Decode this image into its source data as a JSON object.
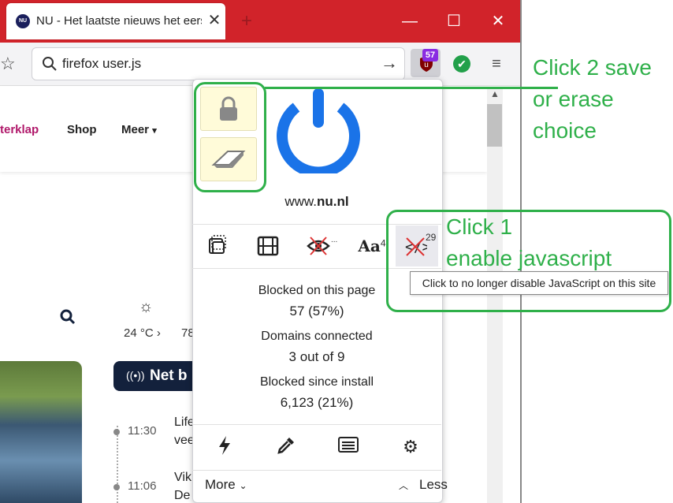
{
  "browser": {
    "tab_title": "NU - Het laatste nieuws het eerst op NU.nl",
    "tab_favicon": "NU",
    "close_glyph": "✕",
    "new_tab_glyph": "+",
    "window_controls": {
      "minimize": "—",
      "maximize": "☐",
      "close": "✕"
    },
    "url_text": "firefox user.js",
    "go_glyph": "→",
    "bookmark_glyph": "☆",
    "menu_glyph": "≡",
    "ubo_badge": "57",
    "check_glyph": "✔"
  },
  "page": {
    "nav_items": [
      "terklap",
      "Shop",
      "Meer"
    ],
    "weather_temp": "24 °C ›",
    "weather_temp2": "78",
    "net_label": "Net b",
    "timeline": [
      {
        "time": "11:30",
        "line1": "Life",
        "line2": "vee"
      },
      {
        "time": "11:06",
        "line1": "Vik",
        "line2": "De"
      }
    ]
  },
  "popup": {
    "hostname_prefix": "www.",
    "hostname_domain": "nu.nl",
    "font_count": "4",
    "script_count": "29",
    "font_label": "Aa",
    "stats": [
      {
        "label": "Blocked on this page",
        "value": "57 (57%)"
      },
      {
        "label": "Domains connected",
        "value": "3 out of 9"
      },
      {
        "label": "Blocked since install",
        "value": "6,123 (21%)"
      }
    ],
    "more_label": "More",
    "less_label": "Less",
    "tooltip": "Click to no longer disable JavaScript on this site"
  },
  "annotations": {
    "click2_lines": [
      "Click 2 save",
      "or erase",
      "choice"
    ],
    "click1_lines": [
      "Click 1",
      "enable javascript"
    ],
    "color": "#2fb04a"
  },
  "colors": {
    "brand_red": "#d1232a",
    "power_blue": "#1a73e8",
    "ubo_badge": "#8a2be2"
  }
}
